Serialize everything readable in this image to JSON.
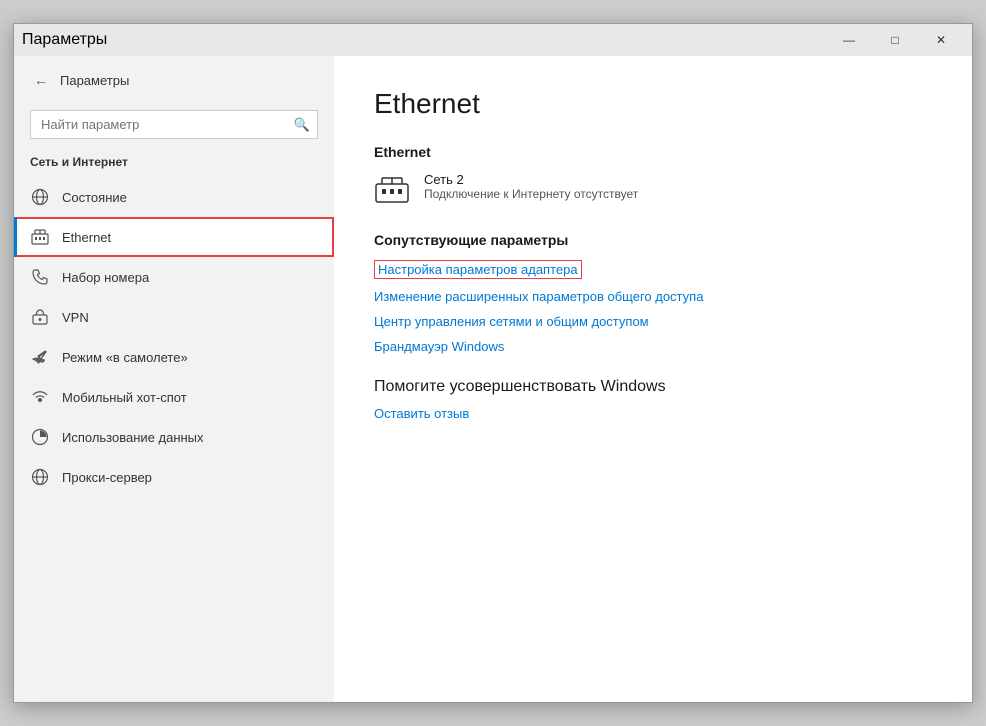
{
  "window": {
    "title": "Параметры",
    "controls": {
      "minimize": "—",
      "maximize": "□",
      "close": "✕"
    }
  },
  "sidebar": {
    "back_label": "←",
    "app_title": "Параметры",
    "search_placeholder": "Найти параметр",
    "search_icon": "🔍",
    "section_title": "Сеть и Интернет",
    "items": [
      {
        "id": "status",
        "label": "Состояние",
        "icon": "globe"
      },
      {
        "id": "ethernet",
        "label": "Ethernet",
        "icon": "ethernet",
        "active": true,
        "highlighted": true
      },
      {
        "id": "dialup",
        "label": "Набор номера",
        "icon": "phone"
      },
      {
        "id": "vpn",
        "label": "VPN",
        "icon": "vpn"
      },
      {
        "id": "airplane",
        "label": "Режим «в самолете»",
        "icon": "airplane"
      },
      {
        "id": "hotspot",
        "label": "Мобильный хот-спот",
        "icon": "hotspot"
      },
      {
        "id": "data_usage",
        "label": "Использование данных",
        "icon": "data"
      },
      {
        "id": "proxy",
        "label": "Прокси-сервер",
        "icon": "proxy"
      }
    ]
  },
  "main": {
    "title": "Ethernet",
    "ethernet_section_label": "Ethernet",
    "network_name": "Сеть 2",
    "network_status": "Подключение к Интернету отсутствует",
    "related_params_title": "Сопутствующие параметры",
    "links": [
      {
        "id": "adapter",
        "label": "Настройка параметров адаптера",
        "highlighted": true
      },
      {
        "id": "sharing",
        "label": "Изменение расширенных параметров общего доступа",
        "highlighted": false
      },
      {
        "id": "network_center",
        "label": "Центр управления сетями и общим доступом",
        "highlighted": false
      },
      {
        "id": "firewall",
        "label": "Брандмауэр Windows",
        "highlighted": false
      }
    ],
    "improve_title": "Помогите усовершенствовать Windows",
    "feedback_link": "Оставить отзыв"
  }
}
